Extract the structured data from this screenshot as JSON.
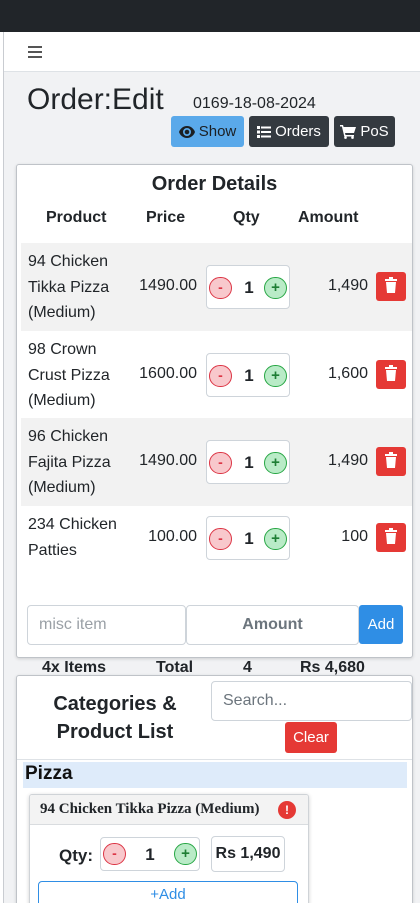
{
  "header": {
    "title": "Order:Edit",
    "order_id": "0169-18-08-2024",
    "buttons": {
      "show": "Show",
      "orders": "Orders",
      "pos": "PoS"
    }
  },
  "order_details": {
    "title": "Order Details",
    "columns": [
      "Product",
      "Price",
      "Qty",
      "Amount"
    ],
    "rows": [
      {
        "product": [
          "94 Chicken",
          "Tikka Pizza",
          "(Medium)"
        ],
        "price": "1490.00",
        "qty": "1",
        "amount": "1,490"
      },
      {
        "product": [
          "98 Crown",
          "Crust Pizza",
          "(Medium)"
        ],
        "price": "1600.00",
        "qty": "1",
        "amount": "1,600"
      },
      {
        "product": [
          "96 Chicken",
          "Fajita Pizza",
          "(Medium)"
        ],
        "price": "1490.00",
        "qty": "1",
        "amount": "1,490"
      },
      {
        "product": [
          "234 Chicken",
          "Patties"
        ],
        "price": "100.00",
        "qty": "1",
        "amount": "100"
      }
    ],
    "stepper": {
      "minus": "-",
      "plus": "+"
    },
    "misc_placeholder": "misc item",
    "amount_placeholder": "Amount",
    "add_label": "Add",
    "footer": {
      "items": "4x Items",
      "total_label": "Total",
      "qty_total": "4",
      "grand_total": "Rs 4,680"
    }
  },
  "categories": {
    "title_line1": "Categories &",
    "title_line2": "Product List",
    "search_placeholder": "Search...",
    "clear_label": "Clear",
    "category_name": "Pizza",
    "product_card": {
      "name": "94 Chicken Tikka Pizza (Medium)",
      "alert": "!",
      "qty_label": "Qty:",
      "qty": "1",
      "price": "Rs 1,490",
      "add_label": "+Add"
    }
  },
  "colors": {
    "show_button": "#5aa9ea",
    "dark_button": "#343a40",
    "danger": "#e53935",
    "primary": "#2f8ee5",
    "category_header": "#deebfa"
  },
  "icons": {
    "menu": "hamburger-icon",
    "show": "eye-icon",
    "orders": "list-icon",
    "pos": "cart-icon",
    "delete": "trash-icon"
  }
}
